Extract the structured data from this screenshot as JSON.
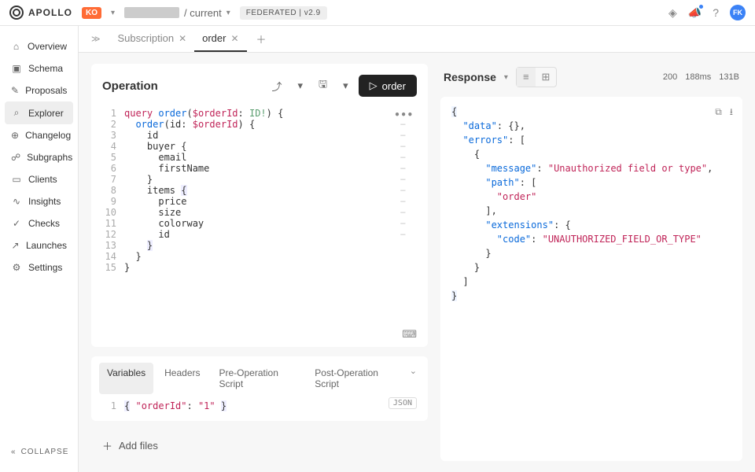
{
  "header": {
    "logo_text": "APOLLO",
    "org_badge": "KO",
    "breadcrumb_current": "/ current",
    "federated_badge": "FEDERATED | v2.9",
    "avatar_initials": "FK"
  },
  "sidebar": {
    "items": [
      {
        "label": "Overview",
        "icon": "⌂"
      },
      {
        "label": "Schema",
        "icon": "▣"
      },
      {
        "label": "Proposals",
        "icon": "✎"
      },
      {
        "label": "Explorer",
        "icon": "⌕",
        "active": true
      },
      {
        "label": "Changelog",
        "icon": "⊕"
      },
      {
        "label": "Subgraphs",
        "icon": "☍"
      },
      {
        "label": "Clients",
        "icon": "▭"
      },
      {
        "label": "Insights",
        "icon": "∿"
      },
      {
        "label": "Checks",
        "icon": "✓"
      },
      {
        "label": "Launches",
        "icon": "↗"
      },
      {
        "label": "Settings",
        "icon": "⚙"
      }
    ],
    "collapse_label": "COLLAPSE"
  },
  "tabs": [
    {
      "label": "Subscription",
      "active": false
    },
    {
      "label": "order",
      "active": true
    }
  ],
  "operation": {
    "title": "Operation",
    "run_label": "order",
    "code_lines": [
      {
        "n": 1,
        "html": "<span class='kw'>query</span> <span class='fn'>order</span>(<span class='var'>$orderId</span>: <span class='type'>ID!</span>) {"
      },
      {
        "n": 2,
        "html": "  <span class='fn'>order</span>(<span class='field'>id</span>: <span class='var'>$orderId</span>) {",
        "fold": true
      },
      {
        "n": 3,
        "html": "    <span class='field'>id</span>",
        "fold": true
      },
      {
        "n": 4,
        "html": "    <span class='field'>buyer</span> {",
        "fold": true
      },
      {
        "n": 5,
        "html": "      <span class='field'>email</span>",
        "fold": true
      },
      {
        "n": 6,
        "html": "      <span class='field'>firstName</span>",
        "fold": true
      },
      {
        "n": 7,
        "html": "    }",
        "fold": true
      },
      {
        "n": 8,
        "html": "    <span class='field'>items</span> <span class='hl'>{</span>",
        "fold": true
      },
      {
        "n": 9,
        "html": "      <span class='field'>price</span>",
        "fold": true
      },
      {
        "n": 10,
        "html": "      <span class='field'>size</span>",
        "fold": true
      },
      {
        "n": 11,
        "html": "      <span class='field'>colorway</span>",
        "fold": true
      },
      {
        "n": 12,
        "html": "      <span class='field'>id</span>",
        "fold": true
      },
      {
        "n": 13,
        "html": "    <span class='hl'>}</span>"
      },
      {
        "n": 14,
        "html": "  }"
      },
      {
        "n": 15,
        "html": "}"
      }
    ]
  },
  "variables": {
    "tabs": [
      "Variables",
      "Headers",
      "Pre-Operation Script",
      "Post-Operation Script"
    ],
    "active_tab": 0,
    "json_badge": "JSON",
    "body": "<span class='hl'>{</span> <span class='str'>\"orderId\"</span>: <span class='str'>\"1\"</span> <span class='hl'>}</span>",
    "line_num": "1"
  },
  "add_files_label": "Add files",
  "response": {
    "title": "Response",
    "status": "200",
    "time": "188ms",
    "size": "131B",
    "body_lines": [
      "<span class='jhl'>{</span>",
      "  <span class='jkey'>\"data\"</span>: {},",
      "  <span class='jkey'>\"errors\"</span>: [",
      "    {",
      "      <span class='jkey'>\"message\"</span>: <span class='jstr'>\"Unauthorized field or type\"</span>,",
      "      <span class='jkey'>\"path\"</span>: [",
      "        <span class='jstr'>\"order\"</span>",
      "      ],",
      "      <span class='jkey'>\"extensions\"</span>: {",
      "        <span class='jkey'>\"code\"</span>: <span class='jstr'>\"UNAUTHORIZED_FIELD_OR_TYPE\"</span>",
      "      }",
      "    }",
      "  ]",
      "<span class='jhl'>}</span>"
    ]
  }
}
